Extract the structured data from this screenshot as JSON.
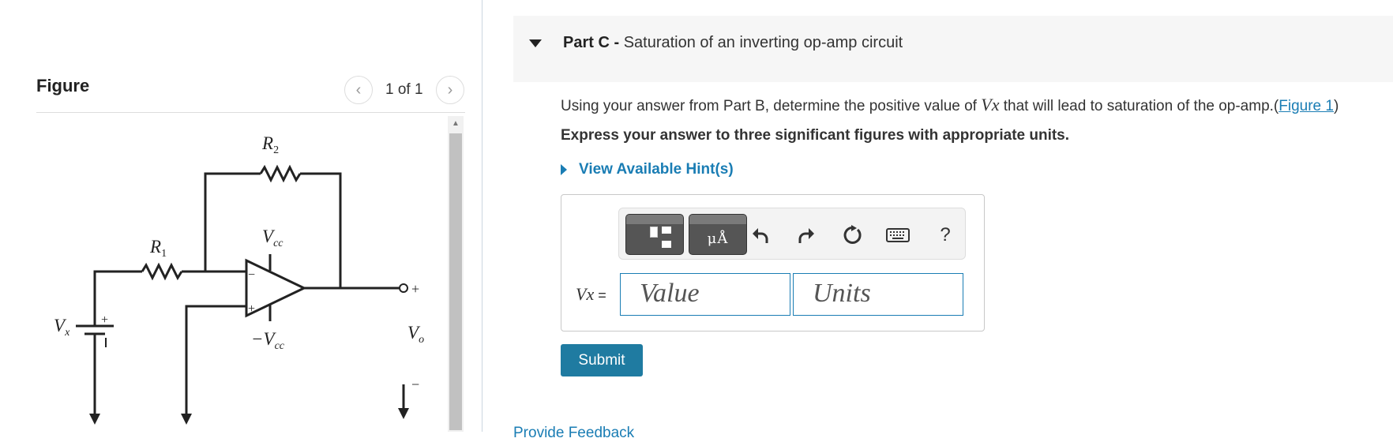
{
  "figure_panel": {
    "title": "Figure",
    "pagination": "1 of 1",
    "circuit_labels": {
      "r1": "R1",
      "r2": "R2",
      "vcc": "Vcc",
      "neg_vcc": "−Vcc",
      "vx": "Vx",
      "vo": "Vo",
      "minus": "−",
      "plus": "+"
    }
  },
  "part": {
    "label": "Part C -",
    "title": "Saturation of an inverting op-amp circuit"
  },
  "question": {
    "text_before": "Using your answer from Part B, determine the positive value of ",
    "variable": "Vx",
    "text_after": " that will lead to saturation of the op-amp.(",
    "figure_link": "Figure 1",
    "closing": ")",
    "instruction": "Express your answer to three significant figures with appropriate units.",
    "hint_link": "View Available Hint(s)"
  },
  "answer": {
    "variable_label": "Vx",
    "equals": "=",
    "value_placeholder": "Value",
    "units_placeholder": "Units",
    "units_button_glyph": "μÅ",
    "help_label": "?"
  },
  "submit_label": "Submit",
  "feedback_link": "Provide Feedback",
  "colors": {
    "accent": "#1a7db4",
    "submit_bg": "#1f7ba1",
    "header_bg": "#f6f6f6",
    "toolbar_btn": "#555555"
  }
}
